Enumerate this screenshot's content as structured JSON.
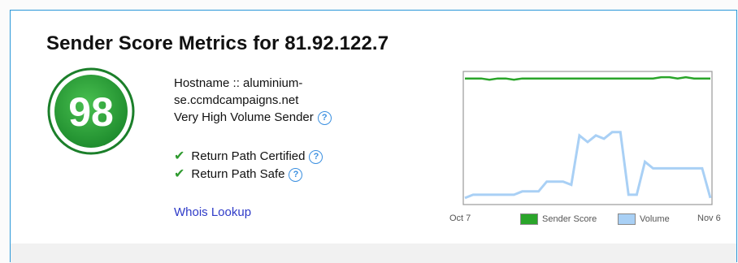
{
  "title": "Sender Score Metrics for 81.92.122.7",
  "score": "98",
  "colors": {
    "score_green": "#27a640",
    "sender_score_line": "#2aa52a",
    "volume_line": "#a9d0f5",
    "link": "#2f3bc8",
    "accent": "#2a97d8"
  },
  "info": {
    "hostname_line1": "Hostname :: aluminium-",
    "hostname_line2": "se.ccmdcampaigns.net",
    "volume_label": "Very High Volume Sender"
  },
  "certifications": [
    {
      "label": "Return Path Certified",
      "icon": "check-icon"
    },
    {
      "label": "Return Path Safe",
      "icon": "check-icon"
    }
  ],
  "help_glyph": "?",
  "whois_link": "Whois Lookup",
  "chart_data": {
    "type": "line",
    "x_start_label": "Oct 7",
    "x_end_label": "Nov 6",
    "series": [
      {
        "name": "Sender Score",
        "color": "#2aa52a",
        "values": [
          97,
          97,
          97,
          96,
          97,
          97,
          96,
          97,
          97,
          97,
          97,
          97,
          97,
          97,
          97,
          97,
          97,
          97,
          97,
          97,
          97,
          97,
          97,
          97,
          98,
          98,
          97,
          98,
          97,
          97,
          97
        ]
      },
      {
        "name": "Volume",
        "color": "#a9d0f5",
        "values": [
          1,
          2,
          2,
          2,
          2,
          2,
          2,
          3,
          3,
          3,
          6,
          6,
          6,
          5,
          20,
          18,
          20,
          19,
          21,
          21,
          2,
          2,
          12,
          10,
          10,
          10,
          10,
          10,
          10,
          10,
          1
        ]
      }
    ],
    "ylim": [
      0,
      100
    ],
    "grid": false,
    "legend": "bottom"
  }
}
